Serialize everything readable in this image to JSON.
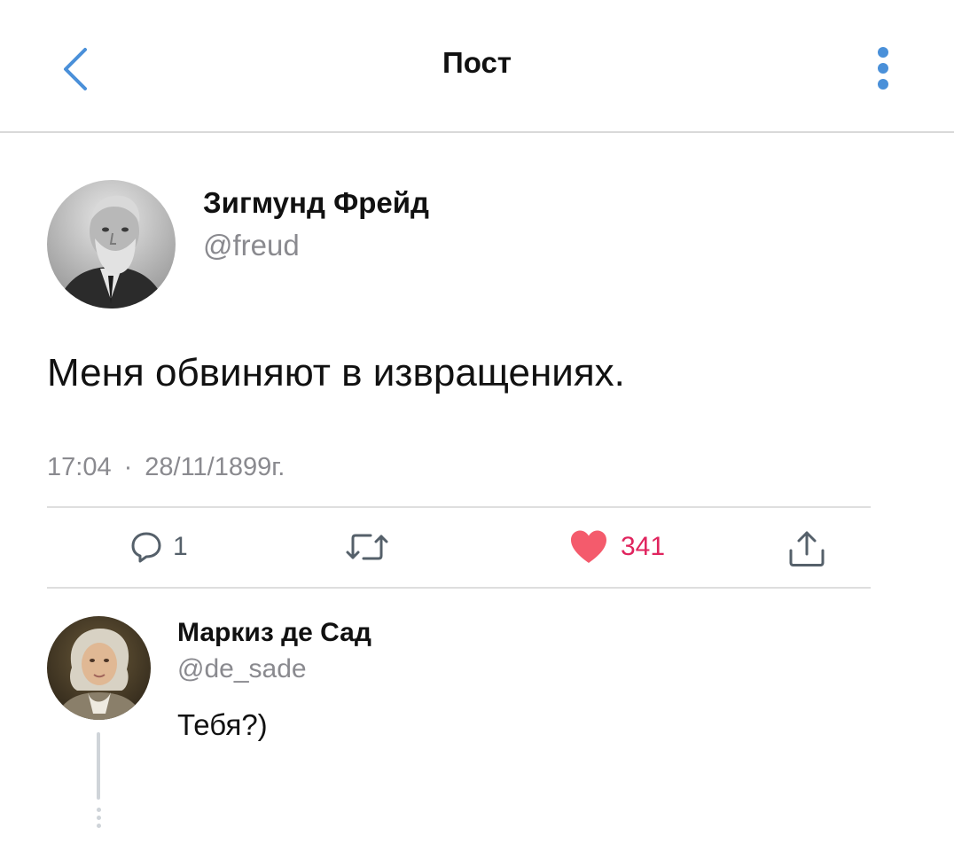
{
  "header": {
    "title": "Пост",
    "back_icon": "chevron-left-icon",
    "more_icon": "more-vertical-icon",
    "accent_color": "#4a90d9"
  },
  "post": {
    "author_name": "Зигмунд Фрейд",
    "author_handle": "@freud",
    "text": "Меня обвиняют в извращениях.",
    "time": "17:04",
    "separator": "·",
    "date": "28/11/1899г.",
    "actions": {
      "reply_count": "1",
      "retweet_count": "",
      "like_count": "341",
      "like_color": "#e0245e"
    }
  },
  "reply": {
    "author_name": "Маркиз де Сад",
    "author_handle": "@de_sade",
    "text": "Тебя?)"
  }
}
